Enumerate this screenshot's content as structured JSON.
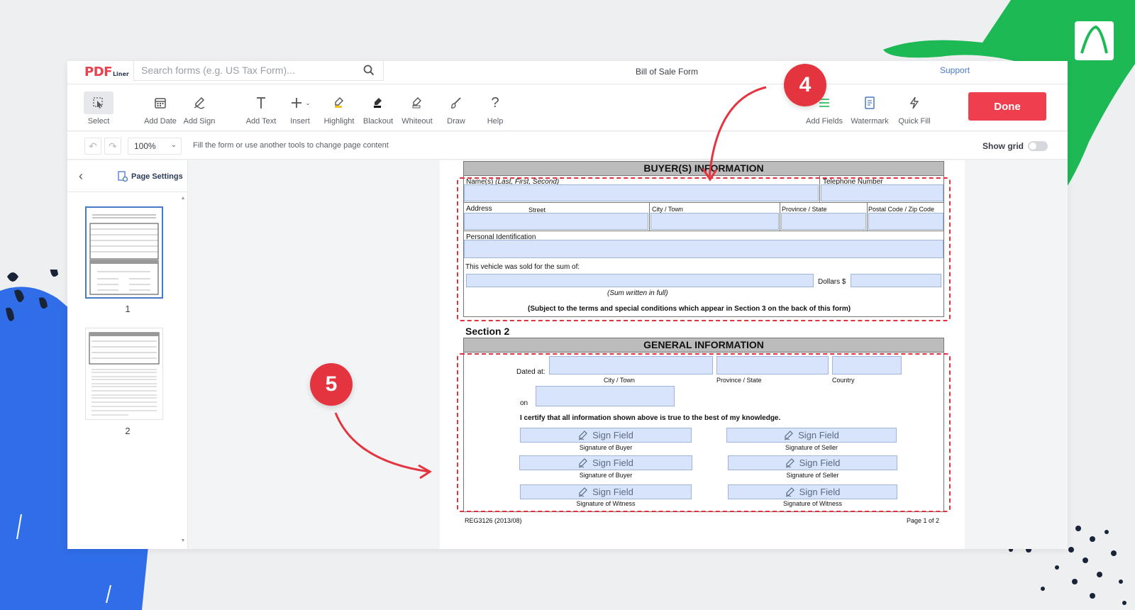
{
  "app": {
    "logo_main": "PDF",
    "logo_sub": "Liner",
    "document_title": "Bill of Sale Form",
    "support_link": "Support"
  },
  "search": {
    "placeholder": "Search forms (e.g. US Tax Form)..."
  },
  "toolbar": {
    "tools_left": [
      {
        "label": "Select",
        "icon": "cursor-icon"
      },
      {
        "label": "Add Date",
        "icon": "calendar-icon"
      },
      {
        "label": "Add Sign",
        "icon": "pen-sign-icon"
      },
      {
        "label": "Add Text",
        "icon": "text-icon"
      },
      {
        "label": "Insert",
        "icon": "plus-icon"
      },
      {
        "label": "Highlight",
        "icon": "highlighter-icon"
      },
      {
        "label": "Blackout",
        "icon": "blackout-icon"
      },
      {
        "label": "Whiteout",
        "icon": "eraser-icon"
      },
      {
        "label": "Draw",
        "icon": "brush-icon"
      },
      {
        "label": "Help",
        "icon": "question-icon"
      }
    ],
    "tools_right": [
      {
        "label": "Add Fields",
        "icon": "fields-icon"
      },
      {
        "label": "Watermark",
        "icon": "watermark-icon"
      },
      {
        "label": "Quick Fill",
        "icon": "lightning-icon"
      }
    ],
    "done_label": "Done"
  },
  "subbar": {
    "zoom": "100%",
    "hint": "Fill the form or use another tools to change page content",
    "show_grid_label": "Show grid",
    "show_grid_on": false
  },
  "sidebar": {
    "page_settings": "Page Settings",
    "pages": [
      "1",
      "2"
    ]
  },
  "form": {
    "buyer_header": "BUYER(S) INFORMATION",
    "name_label": "Name(s) ",
    "name_hint": "(Last, First, Second)",
    "telephone_label": "Telephone Number",
    "address_label": "Address",
    "street_label": "Street",
    "city_town_label": "City / Town",
    "province_state_label": "Province / State",
    "postal_label": "Postal Code / Zip Code",
    "personal_id_label": "Personal Identification",
    "sold_label": "This vehicle was sold for the sum of:",
    "dollars_label": "Dollars $",
    "sum_written": "(Sum written in full)",
    "subject_note": "(Subject to the terms and special conditions which appear in Section 3 on the back of this form)",
    "section2": "Section 2",
    "general_header": "GENERAL INFORMATION",
    "dated_at": "Dated at:",
    "city_town": "City / Town",
    "province_state": "Province / State",
    "country": "Country",
    "on_label": "on",
    "certify": "I certify that all information shown above is true to the best of my knowledge.",
    "sign_field": "Sign Field",
    "sig_buyer": "Signature of Buyer",
    "sig_seller": "Signature of Seller",
    "sig_witness": "Signature of Witness",
    "footer_left": "REG3126 (2013/08)",
    "footer_right": "Page 1 of 2"
  },
  "callouts": {
    "step4": "4",
    "step5": "5"
  },
  "colors": {
    "accent_red": "#ef3f4f",
    "field_blue": "#d7e4fb",
    "deco_green": "#1db954",
    "deco_blue": "#2f6ee8"
  }
}
